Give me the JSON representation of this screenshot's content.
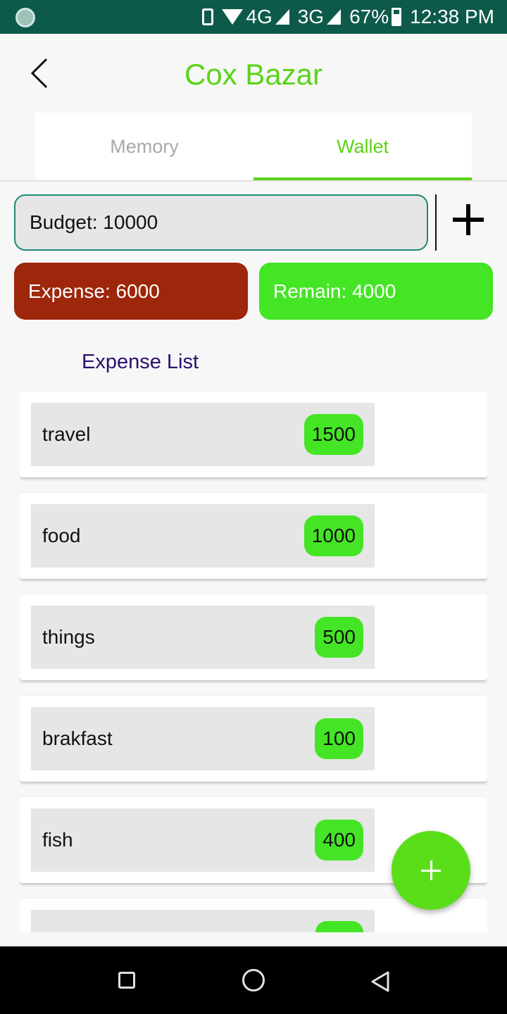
{
  "status_bar": {
    "network_4g": "4G",
    "network_3g": "3G",
    "battery": "67%",
    "time": "12:38 PM"
  },
  "header": {
    "title": "Cox Bazar"
  },
  "tabs": [
    {
      "label": "Memory",
      "active": false
    },
    {
      "label": "Wallet",
      "active": true
    }
  ],
  "wallet": {
    "budget": "Budget: 10000",
    "expense": "Expense: 6000",
    "remain": "Remain: 4000",
    "list_title": "Expense List"
  },
  "expenses": [
    {
      "name": "travel",
      "amount": "1500"
    },
    {
      "name": "food",
      "amount": "1000"
    },
    {
      "name": "things",
      "amount": "500"
    },
    {
      "name": "brakfast",
      "amount": "100"
    },
    {
      "name": "fish",
      "amount": "400"
    },
    {
      "name": "",
      "amount": ""
    }
  ],
  "colors": {
    "accent": "#5bd317",
    "expense": "#9d260b",
    "remain": "#44e525",
    "status_bar": "#0d5a4a"
  }
}
